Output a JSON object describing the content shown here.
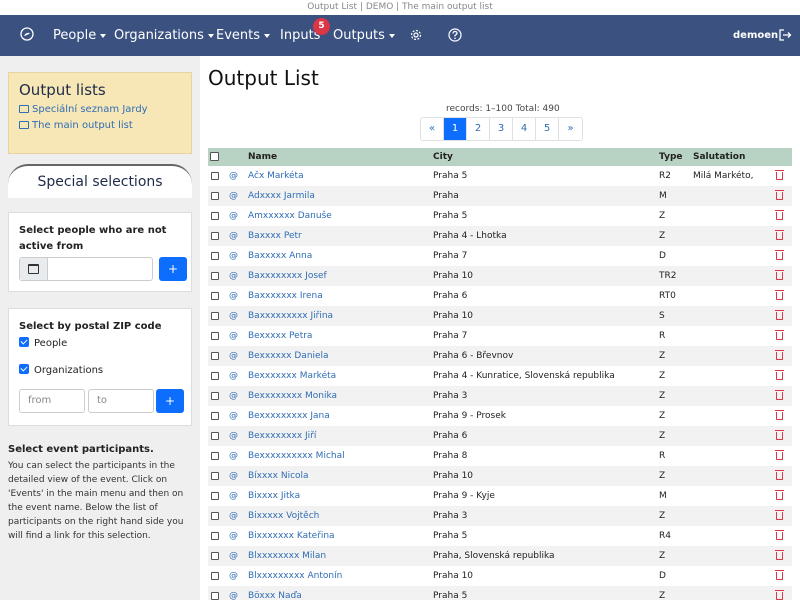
{
  "window_title": "Output List | DEMO | The main output list",
  "nav": {
    "items": [
      {
        "label": "People",
        "has_caret": true
      },
      {
        "label": "Organizations",
        "has_caret": true
      },
      {
        "label": "Events",
        "has_caret": true
      },
      {
        "label": "Inputs",
        "has_caret": false
      },
      {
        "label": "Outputs",
        "has_caret": true
      }
    ],
    "inputs_badge": "5",
    "user": "demoen",
    "logo_icon": "globe-icon",
    "settings_icon": "gear-icon",
    "help_icon": "question-circle-icon",
    "logout_icon": "logout-icon",
    "colors": {
      "navbar_bg": "#3b5180",
      "badge": "#dc3545"
    }
  },
  "sidebar": {
    "output_lists": {
      "title": "Output lists",
      "links": [
        "Speciální seznam Jardy",
        "The main output list"
      ]
    },
    "special_selections_title": "Special selections",
    "inactive": {
      "title": "Select people who are not active from",
      "date_value": "",
      "add_button": "+"
    },
    "zip": {
      "title": "Select by postal ZIP code",
      "people_label": "People",
      "organizations_label": "Organizations",
      "from_placeholder": "from",
      "to_placeholder": "to",
      "add_button": "+"
    },
    "event_participants": {
      "title": "Select event participants.",
      "text": "You can select the participants in the detailed view of the event. Click on 'Events' in the main menu and then on the event name. Below the list of participants on the right hand side you will find a link for this selection."
    }
  },
  "main": {
    "title": "Output List",
    "records_text": "records: 1–100  Total: 490",
    "pagination": [
      "«",
      "1",
      "2",
      "3",
      "4",
      "5",
      "»"
    ],
    "pagination_active": "1",
    "columns": {
      "name": "Name",
      "city": "City",
      "type": "Type",
      "salutation": "Salutation"
    },
    "email_symbol": "@",
    "rows": [
      {
        "name": "Ačx Markéta",
        "city": "Praha 5",
        "type": "R2",
        "salutation": "Milá Markéto,"
      },
      {
        "name": "Adxxxx Jarmila",
        "city": "Praha",
        "type": "M",
        "salutation": ""
      },
      {
        "name": "Amxxxxxx Danuše",
        "city": "Praha 5",
        "type": "Z",
        "salutation": ""
      },
      {
        "name": "Baxxxx Petr",
        "city": "Praha 4 - Lhotka",
        "type": "Z",
        "salutation": ""
      },
      {
        "name": "Baxxxxx Anna",
        "city": "Praha 7",
        "type": "D",
        "salutation": ""
      },
      {
        "name": "Baxxxxxxxx Josef",
        "city": "Praha 10",
        "type": "TR2",
        "salutation": ""
      },
      {
        "name": "Baxxxxxxx Irena",
        "city": "Praha 6",
        "type": "RT0",
        "salutation": ""
      },
      {
        "name": "Baxxxxxxxxx Jiřina",
        "city": "Praha 10",
        "type": "S",
        "salutation": ""
      },
      {
        "name": "Bexxxxx Petra",
        "city": "Praha 7",
        "type": "R",
        "salutation": ""
      },
      {
        "name": "Bexxxxxx Daniela",
        "city": "Praha 6 - Břevnov",
        "type": "Z",
        "salutation": ""
      },
      {
        "name": "Bexxxxxxx Markéta",
        "city": "Praha 4 - Kunratice, Slovenská republika",
        "type": "Z",
        "salutation": ""
      },
      {
        "name": "Bexxxxxxxx Monika",
        "city": "Praha 3",
        "type": "Z",
        "salutation": ""
      },
      {
        "name": "Bexxxxxxxxx Jana",
        "city": "Praha 9 - Prosek",
        "type": "Z",
        "salutation": ""
      },
      {
        "name": "Bexxxxxxxx Jiří",
        "city": "Praha 6",
        "type": "Z",
        "salutation": ""
      },
      {
        "name": "Bexxxxxxxxxx Michal",
        "city": "Praha 8",
        "type": "R",
        "salutation": ""
      },
      {
        "name": "Bíxxxx Nicola",
        "city": "Praha 10",
        "type": "Z",
        "salutation": ""
      },
      {
        "name": "Bixxxx Jitka",
        "city": "Praha 9 - Kyje",
        "type": "M",
        "salutation": ""
      },
      {
        "name": "Bixxxxx Vojtěch",
        "city": "Praha 3",
        "type": "Z",
        "salutation": ""
      },
      {
        "name": "Bixxxxxxx Kateřina",
        "city": "Praha 5",
        "type": "R4",
        "salutation": ""
      },
      {
        "name": "Blxxxxxxxx Milan",
        "city": "Praha, Slovenská republika",
        "type": "Z",
        "salutation": ""
      },
      {
        "name": "Blxxxxxxxxx Antonín",
        "city": "Praha 10",
        "type": "D",
        "salutation": ""
      },
      {
        "name": "Böxxx Naďa",
        "city": "Praha 5",
        "type": "Z",
        "salutation": ""
      }
    ]
  }
}
